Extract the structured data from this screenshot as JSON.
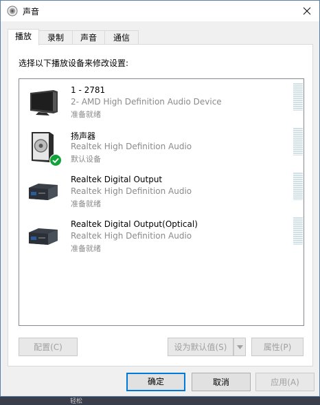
{
  "window": {
    "title": "声音"
  },
  "tabs": [
    {
      "label": "播放",
      "active": true
    },
    {
      "label": "录制",
      "active": false
    },
    {
      "label": "声音",
      "active": false
    },
    {
      "label": "通信",
      "active": false
    }
  ],
  "instruction": "选择以下播放设备来修改设置:",
  "devices": [
    {
      "name": "1 - 2781",
      "description": "2- AMD High Definition Audio Device",
      "status": "准备就绪",
      "icon": "monitor-icon",
      "is_default": false
    },
    {
      "name": "扬声器",
      "description": "Realtek High Definition Audio",
      "status": "默认设备",
      "icon": "speaker-icon",
      "is_default": true
    },
    {
      "name": "Realtek Digital Output",
      "description": "Realtek High Definition Audio",
      "status": "准备就绪",
      "icon": "digital-output-icon",
      "is_default": false
    },
    {
      "name": "Realtek Digital Output(Optical)",
      "description": "Realtek High Definition Audio",
      "status": "准备就绪",
      "icon": "optical-output-icon",
      "is_default": false
    }
  ],
  "panel_buttons": {
    "configure": "配置(C)",
    "set_default": "设为默认值(S)",
    "properties": "属性(P)"
  },
  "dialog_buttons": {
    "ok": "确定",
    "cancel": "取消",
    "apply": "应用(A)"
  },
  "taskbar": {
    "partial_text": "轻松"
  },
  "colors": {
    "accent": "#0078d7",
    "default_check": "#10a33a",
    "meter": "#cfe0e6"
  }
}
